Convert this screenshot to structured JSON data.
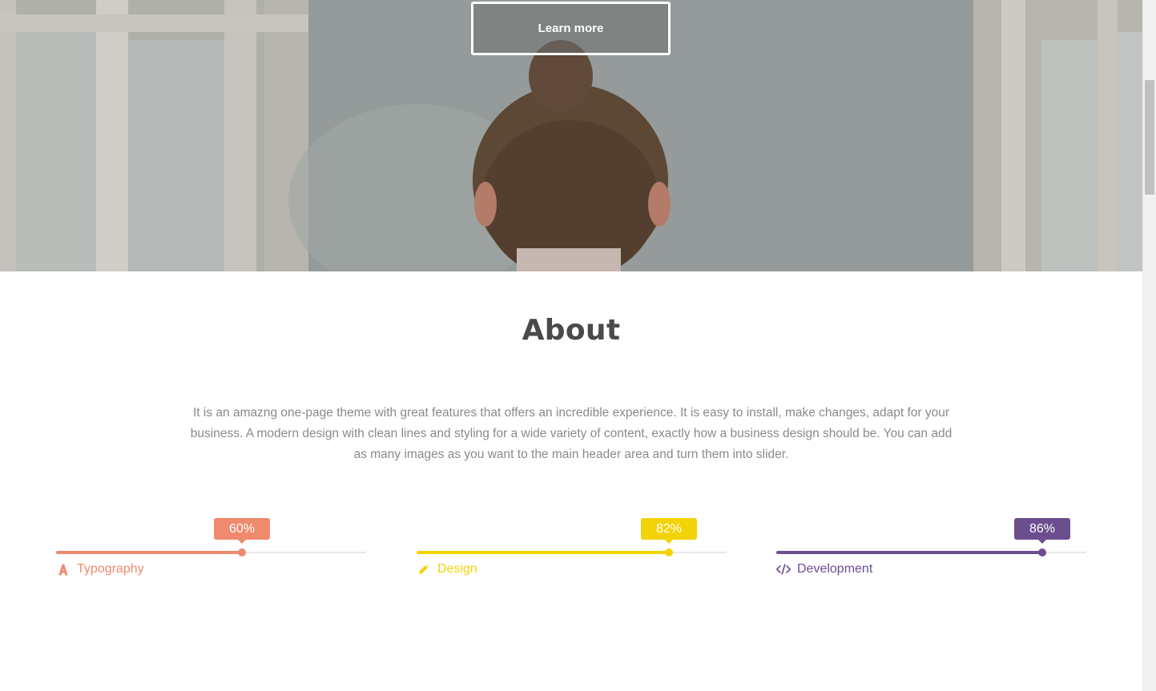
{
  "hero": {
    "button_label": "Learn more"
  },
  "about": {
    "title": "About",
    "text": "It is an amazng one-page theme with great features that offers an incredible experience. It is easy to install, make changes, adapt for your business. A modern design with clean lines and styling for a wide variety of content, exactly how a business design should be. You can add as many images as you want to the main header area and turn them into slider."
  },
  "skills": [
    {
      "label": "Typography",
      "percent_label": "60%",
      "percent": 60,
      "color": "#ef8a6e",
      "icon": "font-icon"
    },
    {
      "label": "Design",
      "percent_label": "82%",
      "percent": 82,
      "color": "#f2d308",
      "icon": "pencil-icon"
    },
    {
      "label": "Development",
      "percent_label": "86%",
      "percent": 86,
      "color": "#6b4e8e",
      "icon": "code-icon"
    }
  ],
  "colors": {
    "heading": "#4a4a4a",
    "body_text": "#8a8a8a",
    "track": "#e8e8e8"
  }
}
